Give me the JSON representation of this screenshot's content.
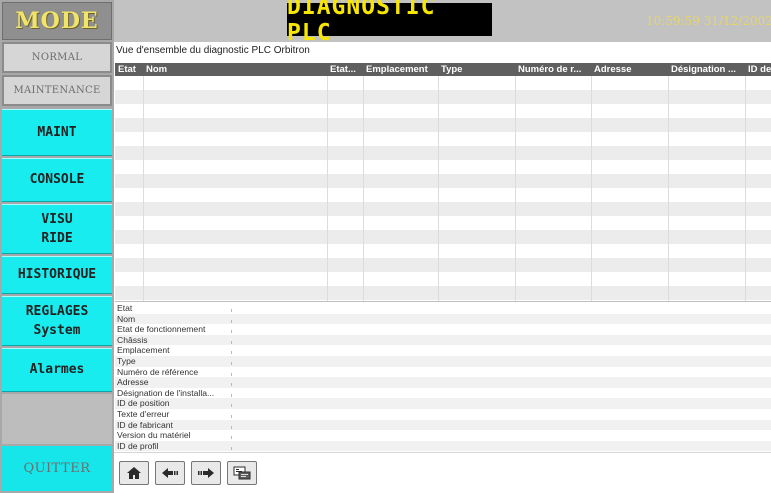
{
  "sidebar": {
    "mode_title": "MODE",
    "mode_normal": "NORMAL",
    "mode_maintenance": "MAINTENANCE",
    "nav": {
      "maint": "MAINT",
      "console": "CONSOLE",
      "visu_ride": "VISU\nRIDE",
      "historique": "HISTORIQUE",
      "reglages": "REGLAGES\nSystem",
      "alarmes": "Alarmes"
    },
    "quit": "QUITTER"
  },
  "header": {
    "title": "DIAGNOSTIC PLC",
    "clock": "10:59:59 31/12/2002"
  },
  "overview": {
    "title": "Vue d'ensemble du diagnostic PLC Orbitron",
    "columns": [
      "Etat",
      "Nom",
      "Etat...",
      "Emplacement",
      "Type",
      "Numéro de r...",
      "Adresse",
      "Désignation ...",
      "ID de"
    ],
    "row_count": 16
  },
  "properties": [
    "Etat",
    "Nom",
    "Etat de fonctionnement",
    "Châssis",
    "Emplacement",
    "Type",
    "Numéro de référence",
    "Adresse",
    "Désignation de l'installa...",
    "ID de position",
    "Texte d'erreur",
    "ID de fabricant",
    "Version du matériel",
    "ID de profil"
  ],
  "toolbar": {
    "icons": [
      "home-icon",
      "back-icon",
      "forward-icon",
      "diagnostic-buffer-icon"
    ]
  },
  "colors": {
    "nav_cyan": "#19ecef",
    "title_yellow": "#f6e600",
    "header_gray": "#5f5f5f"
  }
}
